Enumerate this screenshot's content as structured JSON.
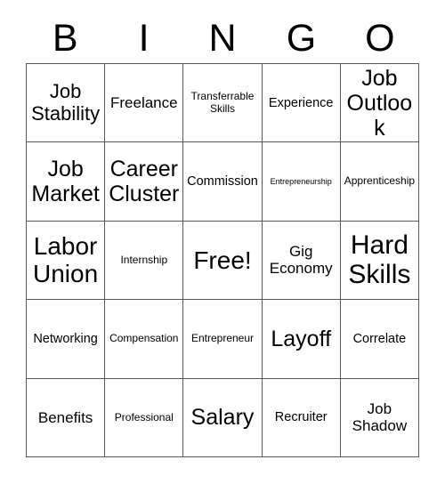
{
  "card": {
    "title_letters": [
      "B",
      "I",
      "N",
      "G",
      "O"
    ],
    "colors": {
      "background": "#ffffff",
      "text": "#000000",
      "border": "#595959"
    },
    "grid": {
      "rows": 5,
      "columns": 5,
      "cells": [
        {
          "text": "Job\nStability",
          "size": "xl"
        },
        {
          "text": "Freelance",
          "size": "lg"
        },
        {
          "text": "Transferrable\nSkills",
          "size": "sm"
        },
        {
          "text": "Experience",
          "size": "md"
        },
        {
          "text": "Job\nOutlook",
          "size": "xxl"
        },
        {
          "text": "Job\nMarket",
          "size": "xxl"
        },
        {
          "text": "Career\nCluster",
          "size": "xxl"
        },
        {
          "text": "Commission",
          "size": "md"
        },
        {
          "text": "Entrepreneurship",
          "size": "xs"
        },
        {
          "text": "Apprenticeship",
          "size": "sm"
        },
        {
          "text": "Labor\nUnion",
          "size": "huge"
        },
        {
          "text": "Internship",
          "size": "sm"
        },
        {
          "text": "Free!",
          "size": "huge"
        },
        {
          "text": "Gig\nEconomy",
          "size": "lg"
        },
        {
          "text": "Hard\nSkills",
          "size": "max"
        },
        {
          "text": "Networking",
          "size": "md"
        },
        {
          "text": "Compensation",
          "size": "sm"
        },
        {
          "text": "Entrepreneur",
          "size": "sm"
        },
        {
          "text": "Layoff",
          "size": "xxl"
        },
        {
          "text": "Correlate",
          "size": "md"
        },
        {
          "text": "Benefits",
          "size": "lg"
        },
        {
          "text": "Professional",
          "size": "sm"
        },
        {
          "text": "Salary",
          "size": "xxl"
        },
        {
          "text": "Recruiter",
          "size": "md"
        },
        {
          "text": "Job\nShadow",
          "size": "lg"
        }
      ]
    }
  }
}
